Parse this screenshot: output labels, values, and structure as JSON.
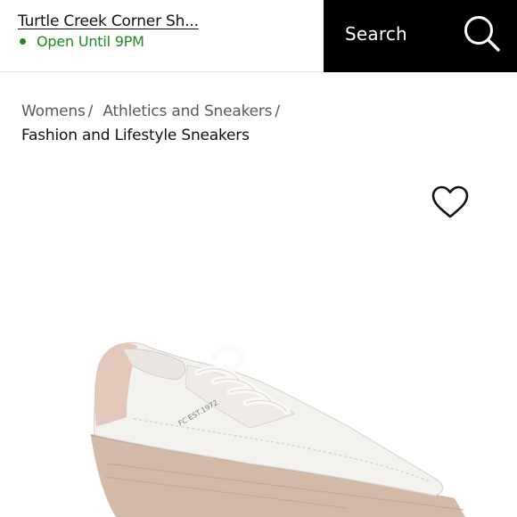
{
  "header": {
    "store_name": "Turtle Creek Corner Sh...",
    "store_status": "Open Until 9PM",
    "search_label": "Search"
  },
  "breadcrumb": {
    "items": [
      "Womens",
      "Athletics and Sneakers"
    ],
    "separator": "/",
    "current": "Fashion and Lifestyle Sneakers"
  },
  "product": {
    "image_text": "FC EST.1972"
  },
  "icons": {
    "search": "search-icon",
    "favorite": "heart-outline-icon",
    "status": "open-status-dot"
  },
  "colors": {
    "header_search_bg": "#000000",
    "status_green": "#1f8a1f",
    "shoe_upper": "#f4f2ee",
    "shoe_sole": "#d3b9a8",
    "heel_tab": "#e3c7bb"
  }
}
